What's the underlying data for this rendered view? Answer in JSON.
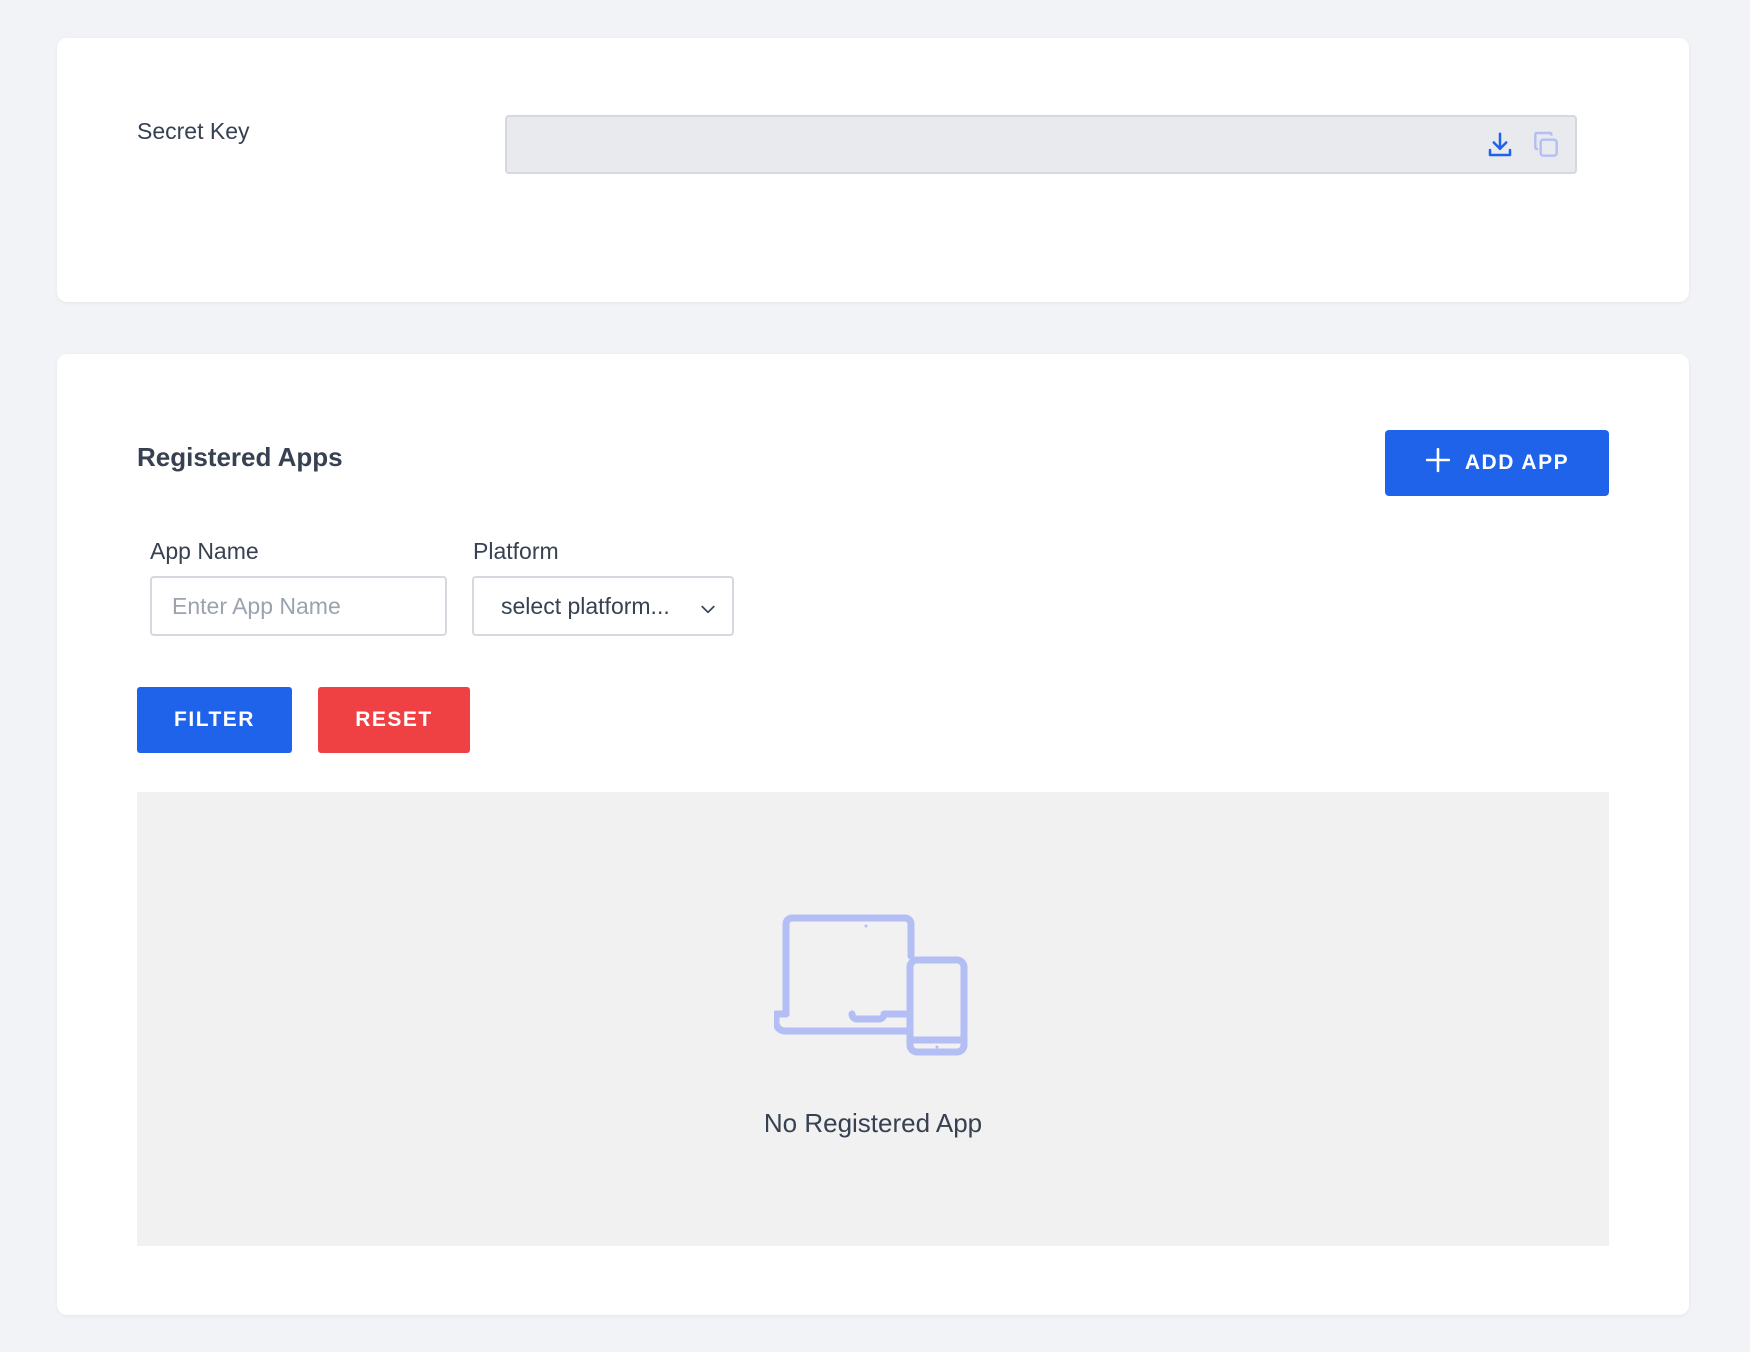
{
  "secret_key": {
    "label": "Secret Key",
    "value": "",
    "download_icon": "download-icon",
    "copy_icon": "copy-icon"
  },
  "registered_apps": {
    "title": "Registered Apps",
    "add_button": {
      "label": "ADD APP",
      "icon": "plus-icon"
    },
    "filters": {
      "app_name": {
        "label": "App Name",
        "placeholder": "Enter App Name",
        "value": ""
      },
      "platform": {
        "label": "Platform",
        "selected": "select platform..."
      }
    },
    "filter_button": "FILTER",
    "reset_button": "RESET",
    "empty_state": {
      "icon": "devices-icon",
      "message": "No Registered App"
    }
  },
  "colors": {
    "primary": "#1e63e9",
    "danger": "#ef4144",
    "icon_muted": "#b3bef5",
    "background": "#f2f3f6"
  }
}
